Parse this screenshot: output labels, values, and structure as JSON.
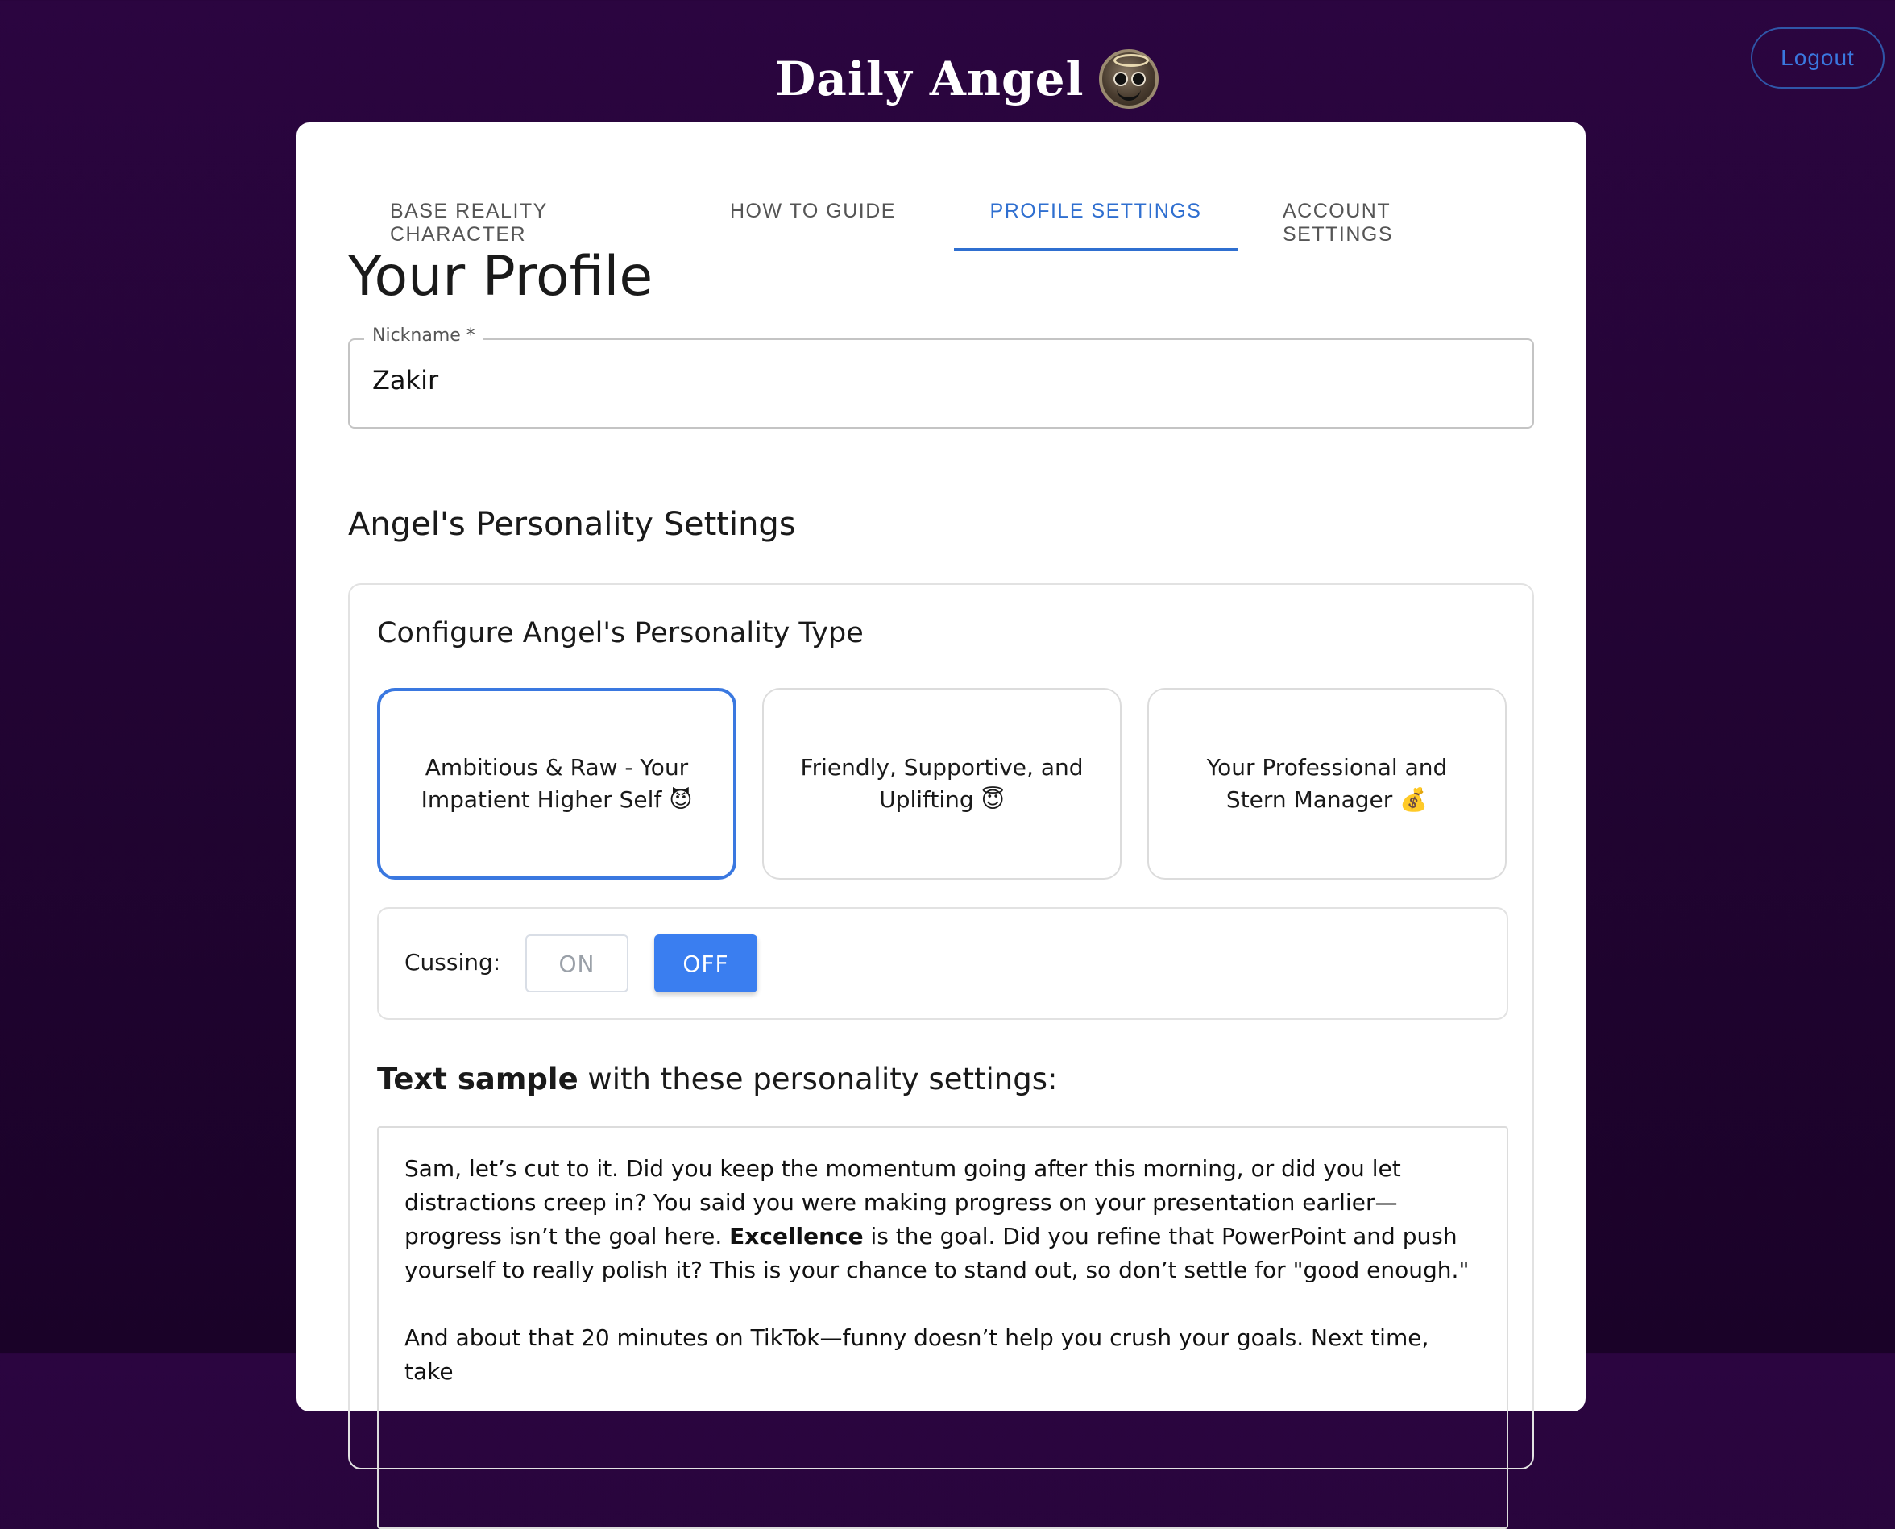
{
  "header": {
    "brand_title": "Daily Angel",
    "brand_logo_icon": "angel-face-logo",
    "logout_label": "Logout"
  },
  "tabs": [
    {
      "label": "BASE REALITY CHARACTER",
      "active": false
    },
    {
      "label": "HOW TO GUIDE",
      "active": false
    },
    {
      "label": "PROFILE SETTINGS",
      "active": true
    },
    {
      "label": "ACCOUNT SETTINGS",
      "active": false
    }
  ],
  "profile": {
    "title": "Your Profile",
    "nickname_label": "Nickname *",
    "nickname_value": "Zakir"
  },
  "personality": {
    "section_title": "Angel's Personality Settings",
    "panel_title": "Configure Angel's Personality Type",
    "types": [
      {
        "label": "Ambitious & Raw - Your Impatient Higher Self 😈",
        "selected": true
      },
      {
        "label": "Friendly, Supportive, and Uplifting 😇",
        "selected": false
      },
      {
        "label": "Your Professional and Stern Manager 💰",
        "selected": false
      }
    ],
    "cussing_label": "Cussing:",
    "cussing_on_label": "ON",
    "cussing_off_label": "OFF",
    "cussing_value": "OFF"
  },
  "sample": {
    "heading_bold": "Text sample",
    "heading_rest": " with these personality settings:",
    "para1_a": "Sam, let’s cut to it. Did you keep the momentum going after this morning, or did you let distractions creep in? You said you were making progress on your presentation earlier—progress isn’t the goal here. ",
    "para1_bold": "Excellence",
    "para1_b": " is the goal. Did you refine that PowerPoint and push yourself to really polish it? This is your chance to stand out, so don’t settle for \"good enough.\"",
    "para2": "And about that 20 minutes on TikTok—funny doesn’t help you crush your goals. Next time, take"
  },
  "colors": {
    "background": "#2b0540",
    "accent": "#3a78e0",
    "off_button": "#3a7ef0"
  }
}
